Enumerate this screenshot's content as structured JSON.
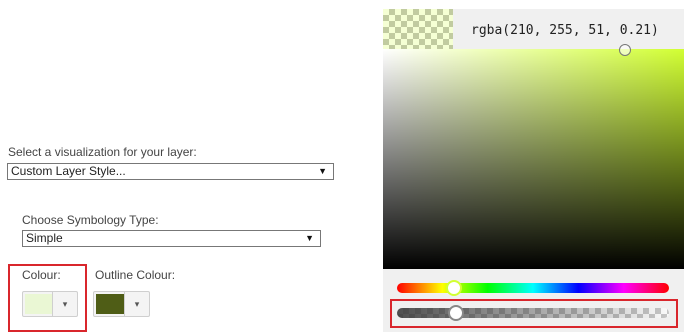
{
  "layer": {
    "visualization_label": "Select a visualization for your layer:",
    "visualization_value": "Custom Layer Style...",
    "symbology_label": "Choose Symbology Type:",
    "symbology_value": "Simple",
    "colour_label": "Colour:",
    "outline_label": "Outline Colour:",
    "dropdown_glyph": "▼",
    "small_dropdown_glyph": "▾",
    "colour_swatch": "#eaf7d4",
    "outline_swatch": "#4f5d16"
  },
  "picker": {
    "value_text": "rgba(210, 255, 51, 0.21)",
    "base_color": "#d2ff33",
    "alpha": 0.21,
    "hue_degrees": 74
  },
  "colors": {
    "highlight": "#d9262c"
  }
}
